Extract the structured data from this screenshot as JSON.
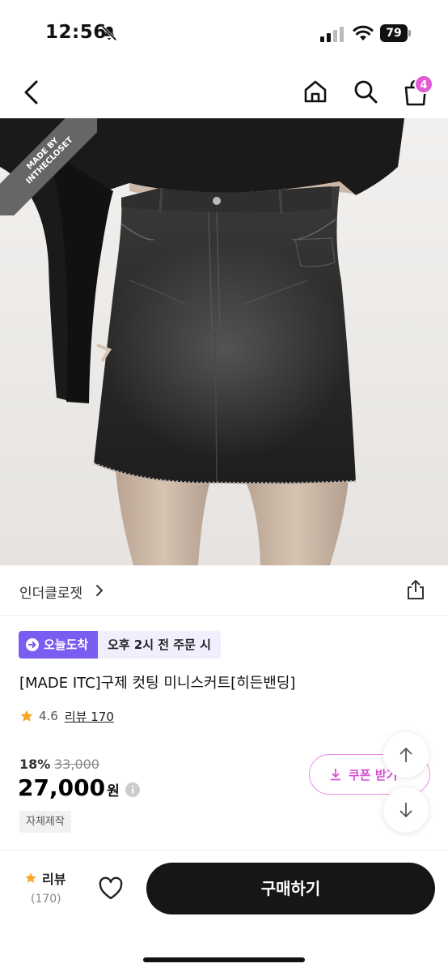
{
  "status_bar": {
    "time": "12:56",
    "battery": "79"
  },
  "nav": {
    "cart_count": "4"
  },
  "product_image": {
    "ribbon_line1": "MADE BY",
    "ribbon_line2": "INTHECLOSET"
  },
  "brand": {
    "name": "인더클로젯"
  },
  "delivery": {
    "badge": "오늘도착",
    "note": "오후 2시 전 주문 시"
  },
  "product": {
    "title": "[MADE ITC]구제 컷팅 미니스커트[히든밴딩]",
    "rating": "4.6",
    "review_link": "리뷰 170",
    "discount": "18%",
    "original_price": "33,000",
    "price": "27,000",
    "currency": "원",
    "tag": "자체제작"
  },
  "coupon": {
    "label": "쿠폰 받기"
  },
  "bottom_bar": {
    "review_label": "리뷰",
    "review_count": "(170)",
    "buy_label": "구매하기"
  },
  "colors": {
    "accent_pink": "#e25ad6",
    "badge_purple": "#7b5cf0",
    "star_orange": "#f5a623",
    "buy_button": "#161616"
  }
}
